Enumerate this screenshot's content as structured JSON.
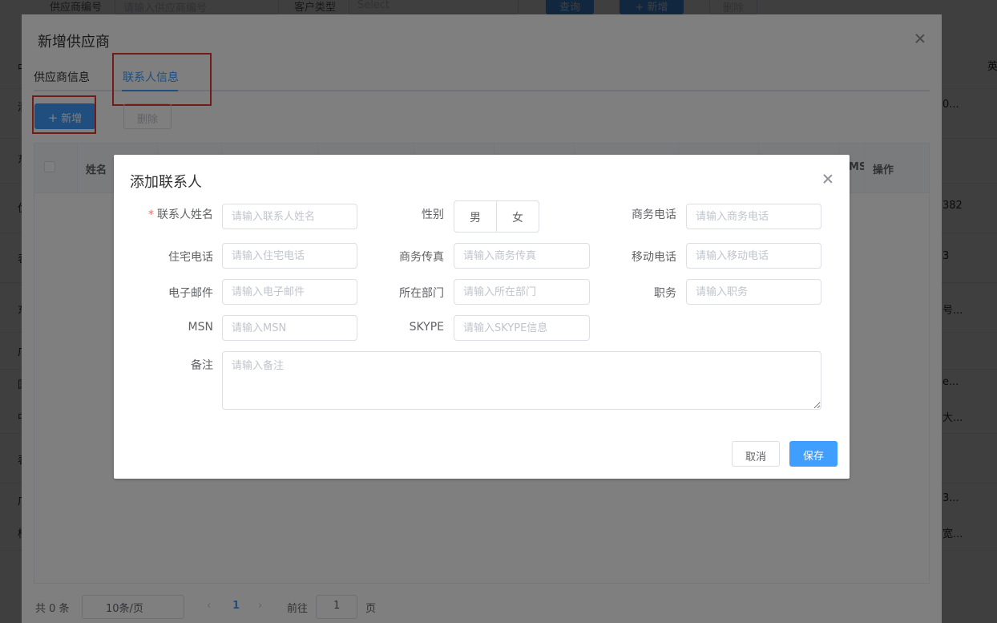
{
  "background": {
    "filter": {
      "supplier_code_label": "供应商编号",
      "supplier_code_placeholder": "请输入供应商编号",
      "customer_type_label": "客户类型",
      "customer_type_placeholder": "Select",
      "search_button": "查询",
      "add_button": "+ 新增",
      "delete_button": "删除"
    },
    "row_fragments_left": [
      "中",
      "清",
      "东",
      "优",
      "表",
      "东",
      "广",
      "国",
      "中",
      "表",
      "广",
      "核"
    ],
    "row_fragments_right": [
      "英",
      "0...",
      "382",
      "3",
      "号...",
      "e...",
      "大...",
      "3...",
      "宽..."
    ]
  },
  "outer_dialog": {
    "title": "新增供应商",
    "tabs": [
      {
        "label": "供应商信息",
        "active": false
      },
      {
        "label": "联系人信息",
        "active": true
      }
    ],
    "add_button": "新增",
    "delete_button": "删除",
    "table_headers": [
      "姓名",
      "MS",
      "操作"
    ],
    "pagination": {
      "total": "共 0 条",
      "page_size": "10条/页",
      "current_page": "1",
      "goto_label": "前往",
      "goto_value": "1",
      "page_unit": "页"
    }
  },
  "dialog": {
    "title": "添加联系人",
    "fields": {
      "contact_name": {
        "label": "联系人姓名",
        "placeholder": "请输入联系人姓名",
        "required": true
      },
      "gender": {
        "label": "性别",
        "options": [
          "男",
          "女"
        ]
      },
      "business_phone": {
        "label": "商务电话",
        "placeholder": "请输入商务电话"
      },
      "home_phone": {
        "label": "住宅电话",
        "placeholder": "请输入住宅电话"
      },
      "business_fax": {
        "label": "商务传真",
        "placeholder": "请输入商务传真"
      },
      "mobile_phone": {
        "label": "移动电话",
        "placeholder": "请输入移动电话"
      },
      "email": {
        "label": "电子邮件",
        "placeholder": "请输入电子邮件"
      },
      "department": {
        "label": "所在部门",
        "placeholder": "请输入所在部门"
      },
      "position": {
        "label": "职务",
        "placeholder": "请输入职务"
      },
      "msn": {
        "label": "MSN",
        "placeholder": "请输入MSN"
      },
      "skype": {
        "label": "SKYPE",
        "placeholder": "请输入SKYPE信息"
      },
      "remark": {
        "label": "备注",
        "placeholder": "请输入备注"
      }
    },
    "cancel_button": "取消",
    "save_button": "保存"
  },
  "colors": {
    "primary": "#409eff",
    "highlight_box": "#e53935",
    "required_star": "#f56c6c"
  }
}
